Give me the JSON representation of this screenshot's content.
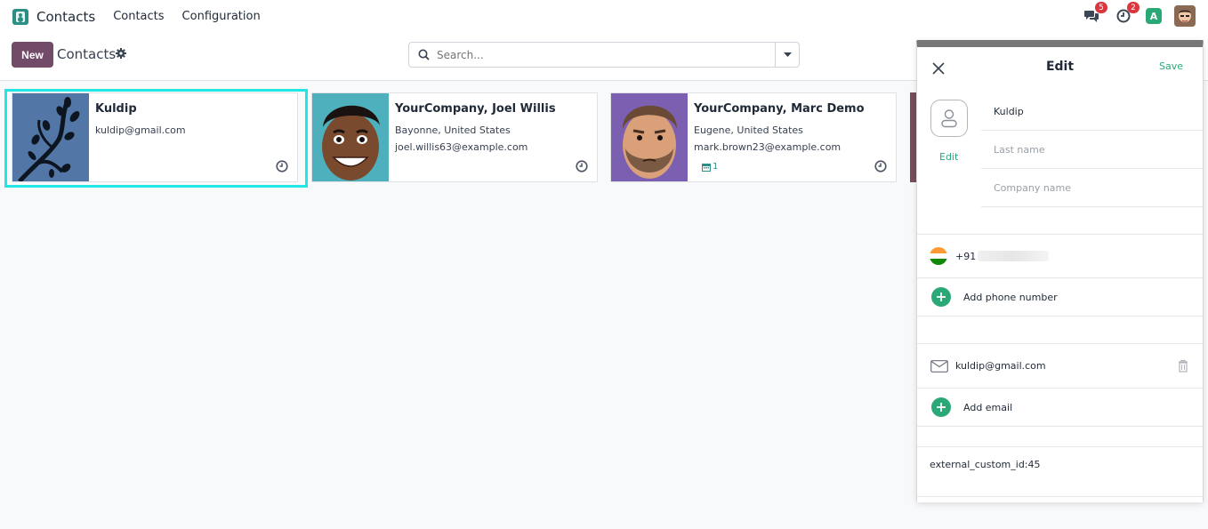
{
  "topnav": {
    "app_name": "Contacts",
    "menu": [
      "Contacts",
      "Configuration"
    ],
    "messages_count": "5",
    "activities_count": "2",
    "user_initial": "A"
  },
  "control": {
    "new_label": "New",
    "title": "Contacts",
    "search_placeholder": "Search..."
  },
  "cards": [
    {
      "name": "Kuldip",
      "lines": [
        "kuldip@gmail.com"
      ],
      "selected": true
    },
    {
      "name": "YourCompany, Joel Willis",
      "lines": [
        "Bayonne, United States",
        "joel.willis63@example.com"
      ]
    },
    {
      "name": "YourCompany, Marc Demo",
      "lines": [
        "Eugene, United States",
        "mark.brown23@example.com"
      ],
      "activity_count": "1"
    }
  ],
  "edit_panel": {
    "title": "Edit",
    "save_label": "Save",
    "avatar_edit_label": "Edit",
    "first_name": "Kuldip",
    "last_name_placeholder": "Last name",
    "company_placeholder": "Company name",
    "phone_prefix": "+91",
    "add_phone_label": "Add phone number",
    "email": "kuldip@gmail.com",
    "add_email_label": "Add email",
    "custom_id": "external_custom_id:45"
  },
  "colors": {
    "brand": "#714b67",
    "accent": "#2aa876",
    "selection": "#22e5e5"
  }
}
